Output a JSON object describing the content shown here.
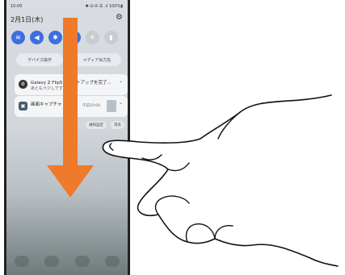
{
  "status": {
    "time": "10:00",
    "icons": "✱ ⊟ ✉ ☰ .ıl 100%▮"
  },
  "header": {
    "date": "2月1日(木)"
  },
  "quick_settings": [
    {
      "icon": "wifi-icon",
      "glyph": "≋",
      "on": true
    },
    {
      "icon": "sound-icon",
      "glyph": "◀",
      "on": true
    },
    {
      "icon": "bluetooth-icon",
      "glyph": "✱",
      "on": true
    },
    {
      "icon": "rotate-icon",
      "glyph": "↻",
      "on": true
    },
    {
      "icon": "airplane-icon",
      "glyph": "✈",
      "on": false
    },
    {
      "icon": "flashlight-icon",
      "glyph": "▮",
      "on": false
    }
  ],
  "pills": {
    "device": "デバイス操作",
    "media": "メディア出力先"
  },
  "notifications": [
    {
      "title": "Galaxy Z Flip5のセットアップを完了...",
      "sub": "あともう少しです"
    },
    {
      "title": "画面キャプチャ",
      "time": "午前10:00"
    }
  ],
  "buttons": {
    "settings": "通知設定",
    "clear": "消去"
  },
  "colors": {
    "arrow": "#ee7a2a",
    "accent": "#3d6fe0"
  }
}
